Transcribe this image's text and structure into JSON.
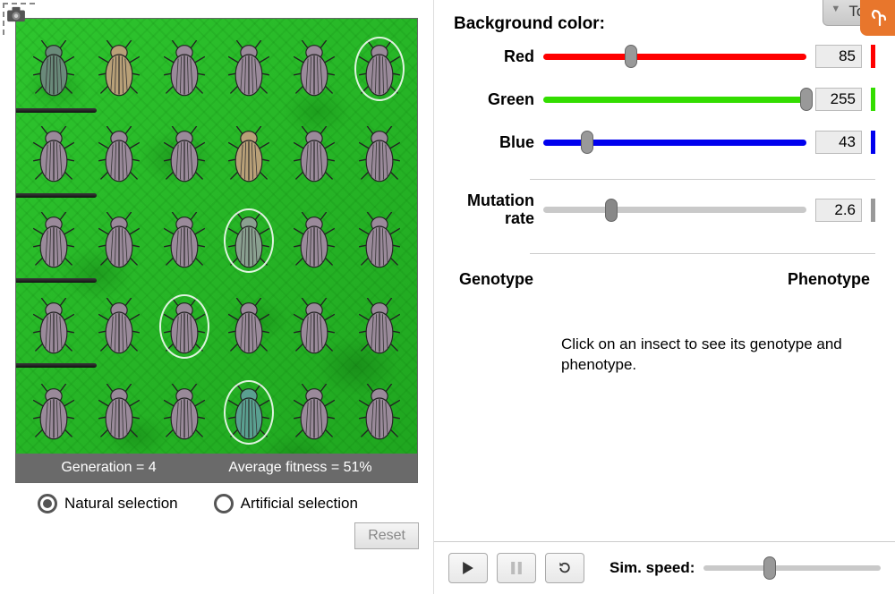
{
  "tools_label": "Tools",
  "status": {
    "generation_label": "Generation = 4",
    "fitness_label": "Average fitness = 51%"
  },
  "selection": {
    "natural": "Natural selection",
    "artificial": "Artificial selection",
    "selected": "natural"
  },
  "reset_label": "Reset",
  "bg_section_title": "Background color:",
  "sliders": {
    "red": {
      "label": "Red",
      "value": "85",
      "pct": 33.3,
      "color": "#ff0000"
    },
    "green": {
      "label": "Green",
      "value": "255",
      "pct": 100,
      "color": "#33dd00"
    },
    "blue": {
      "label": "Blue",
      "value": "43",
      "pct": 16.8,
      "color": "#0000ee"
    },
    "mutation": {
      "label": "Mutation rate",
      "value": "2.6",
      "pct": 26
    }
  },
  "geno_label": "Genotype",
  "pheno_label": "Phenotype",
  "hint_text": "Click on an insect to see its genotype and phenotype.",
  "speed_label": "Sim. speed:",
  "speed_pct": 37,
  "circled_indices": [
    5,
    15,
    20,
    27
  ],
  "insect_tints": [
    "#6a8a7a",
    "#b8a078",
    "#9a8a9a",
    "#9a8a9a",
    "#9a8a9a",
    "#9a8a9a",
    "#9a8a9a",
    "#9a8a9a",
    "#9a8a9a",
    "#b8a078",
    "#9a8a9a",
    "#9a8a9a",
    "#9a8a9a",
    "#9a8a9a",
    "#9a8a9a",
    "#8aa090",
    "#9a8a9a",
    "#9a8a9a",
    "#9a8a9a",
    "#9a8a9a",
    "#9a8a9a",
    "#9a8a9a",
    "#9a8a9a",
    "#9a8a9a",
    "#9a8a9a",
    "#9a8a9a",
    "#9a8a9a",
    "#5aa090",
    "#9a8a9a",
    "#9a8a9a"
  ]
}
